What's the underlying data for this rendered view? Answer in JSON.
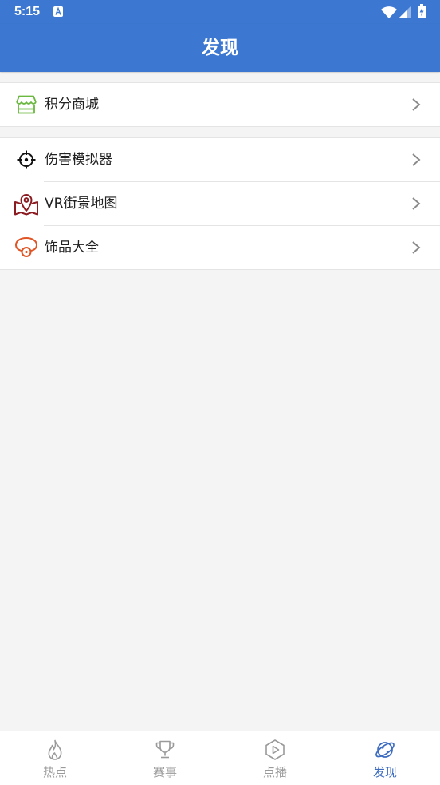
{
  "status_bar": {
    "time": "5:15",
    "icons": [
      "a-notification-icon",
      "wifi-icon",
      "signal-icon",
      "battery-charging-icon"
    ]
  },
  "header": {
    "title": "发现"
  },
  "menu": {
    "groups": [
      {
        "items": [
          {
            "label": "积分商城",
            "icon": "store-icon",
            "icon_color": "#6ab83f"
          }
        ]
      },
      {
        "items": [
          {
            "label": "伤害模拟器",
            "icon": "crosshair-icon",
            "icon_color": "#111111"
          },
          {
            "label": "VR街景地图",
            "icon": "map-pin-icon",
            "icon_color": "#8a1c22"
          },
          {
            "label": "饰品大全",
            "icon": "necklace-icon",
            "icon_color": "#e05525"
          }
        ]
      }
    ],
    "chevron_icon": "chevron-right-icon"
  },
  "tabbar": {
    "tabs": [
      {
        "label": "热点",
        "icon": "flame-icon",
        "active": false
      },
      {
        "label": "赛事",
        "icon": "trophy-icon",
        "active": false
      },
      {
        "label": "点播",
        "icon": "play-hexagon-icon",
        "active": false
      },
      {
        "label": "发现",
        "icon": "planet-icon",
        "active": true
      }
    ]
  },
  "colors": {
    "primary": "#3c78d1",
    "background": "#f4f4f4",
    "tab_active": "#3d6cc0",
    "tab_inactive": "#9a9a9a"
  }
}
